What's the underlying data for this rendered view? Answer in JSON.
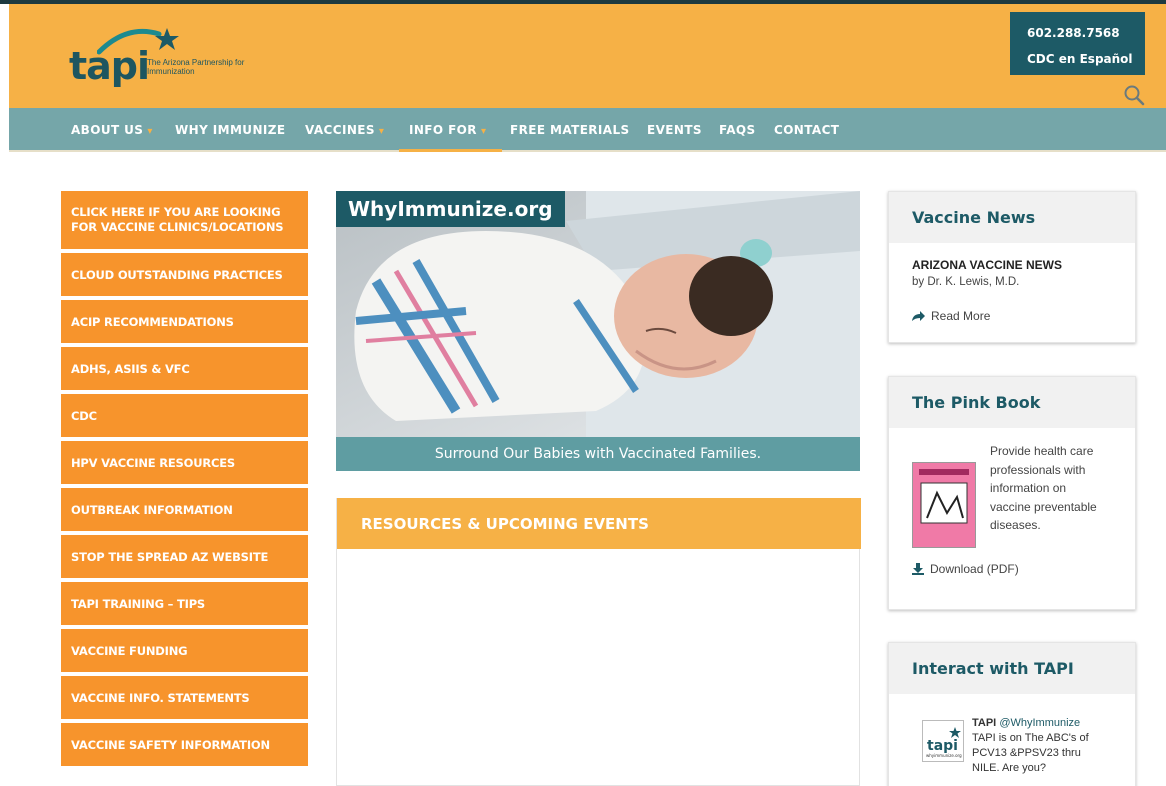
{
  "header": {
    "logo_wordmark": "tapi",
    "logo_tagline": "The Arizona Partnership for Immunization",
    "phone": "602.288.7568",
    "spanish_link": "CDC en Español"
  },
  "nav": {
    "items": [
      {
        "label": "ABOUT US",
        "dropdown": true
      },
      {
        "label": "WHY IMMUNIZE",
        "dropdown": false
      },
      {
        "label": "VACCINES",
        "dropdown": true
      },
      {
        "label": "INFO FOR",
        "dropdown": true,
        "active": true
      },
      {
        "label": "FREE MATERIALS",
        "dropdown": false
      },
      {
        "label": "EVENTS",
        "dropdown": false
      },
      {
        "label": "FAQS",
        "dropdown": false
      },
      {
        "label": "CONTACT",
        "dropdown": false
      }
    ]
  },
  "sidebar": {
    "items": [
      "CLICK HERE IF YOU ARE LOOKING FOR VACCINE CLINICS/LOCATIONS",
      "CLOUD OUTSTANDING PRACTICES",
      "ACIP RECOMMENDATIONS",
      "ADHS, ASIIS & VFC",
      "CDC",
      "HPV VACCINE RESOURCES",
      "OUTBREAK INFORMATION",
      "STOP THE SPREAD AZ WEBSITE",
      "TAPI TRAINING – TIPS",
      "VACCINE FUNDING",
      "VACCINE INFO. STATEMENTS",
      "VACCINE SAFETY INFORMATION"
    ]
  },
  "hero": {
    "title": "WhyImmunize.org",
    "caption": "Surround Our Babies with Vaccinated Families."
  },
  "resources": {
    "heading": "RESOURCES & UPCOMING EVENTS"
  },
  "vaccine_news": {
    "heading": "Vaccine News",
    "article_title": "ARIZONA VACCINE NEWS",
    "byline": "by Dr. K. Lewis, M.D.",
    "read_more": "Read More"
  },
  "pink_book": {
    "heading": "The Pink Book",
    "description": "Provide health care professionals with information on vaccine preventable diseases.",
    "download": "Download (PDF)"
  },
  "interact": {
    "heading": "Interact with TAPI",
    "tweet_author": "TAPI",
    "tweet_handle": "@WhyImmunize",
    "tweet_text": "TAPI is on The ABC's of PCV13 &PPSV23 thru NILE. Are you?",
    "avatar_wordmark": "tapi",
    "avatar_site": "whyimmunize.org"
  },
  "colors": {
    "header_bg": "#f6b146",
    "nav_bg": "#75a6a9",
    "teal_dark": "#1d5a66",
    "sidebar_orange": "#f7942c"
  }
}
